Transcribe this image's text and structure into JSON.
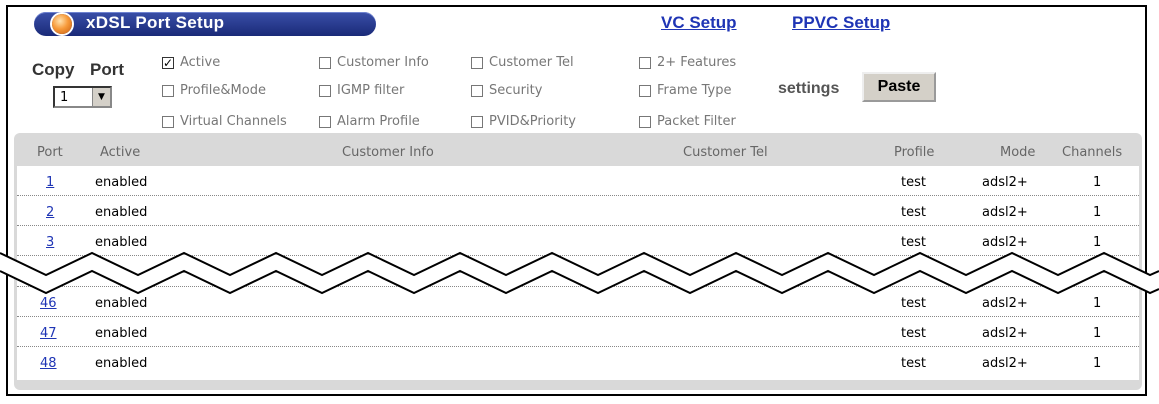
{
  "header": {
    "title": "xDSL Port Setup",
    "links": [
      {
        "label": "VC Setup"
      },
      {
        "label": "PPVC Setup"
      }
    ]
  },
  "copy": {
    "copy_label": "Copy",
    "port_label": "Port",
    "port_value": "1"
  },
  "options": [
    {
      "label": "Active",
      "checked": true
    },
    {
      "label": "Profile&Mode",
      "checked": false
    },
    {
      "label": "Virtual Channels",
      "checked": false
    },
    {
      "label": "Customer Info",
      "checked": false
    },
    {
      "label": "IGMP filter",
      "checked": false
    },
    {
      "label": "Alarm Profile",
      "checked": false
    },
    {
      "label": "Customer Tel",
      "checked": false
    },
    {
      "label": "Security",
      "checked": false
    },
    {
      "label": "PVID&Priority",
      "checked": false
    },
    {
      "label": "2+ Features",
      "checked": false
    },
    {
      "label": "Frame Type",
      "checked": false
    },
    {
      "label": "Packet Filter",
      "checked": false
    }
  ],
  "settings_label": "settings",
  "paste_label": "Paste",
  "table": {
    "columns": [
      "Port",
      "Active",
      "Customer Info",
      "Customer Tel",
      "Profile",
      "Mode",
      "Channels"
    ],
    "rows": [
      {
        "port": "1",
        "active": "enabled",
        "customer_info": "",
        "customer_tel": "",
        "profile": "test",
        "mode": "adsl2+",
        "channels": "1"
      },
      {
        "port": "2",
        "active": "enabled",
        "customer_info": "",
        "customer_tel": "",
        "profile": "test",
        "mode": "adsl2+",
        "channels": "1"
      },
      {
        "port": "3",
        "active": "enabled",
        "customer_info": "",
        "customer_tel": "",
        "profile": "test",
        "mode": "adsl2+",
        "channels": "1"
      },
      {
        "port": "46",
        "active": "enabled",
        "customer_info": "",
        "customer_tel": "",
        "profile": "test",
        "mode": "adsl2+",
        "channels": "1"
      },
      {
        "port": "47",
        "active": "enabled",
        "customer_info": "",
        "customer_tel": "",
        "profile": "test",
        "mode": "adsl2+",
        "channels": "1"
      },
      {
        "port": "48",
        "active": "enabled",
        "customer_info": "",
        "customer_tel": "",
        "profile": "test",
        "mode": "adsl2+",
        "channels": "1"
      }
    ]
  },
  "colors": {
    "title_bar": "#1a2a78",
    "link": "#1f35b5",
    "panel": "#d9d9d9"
  }
}
